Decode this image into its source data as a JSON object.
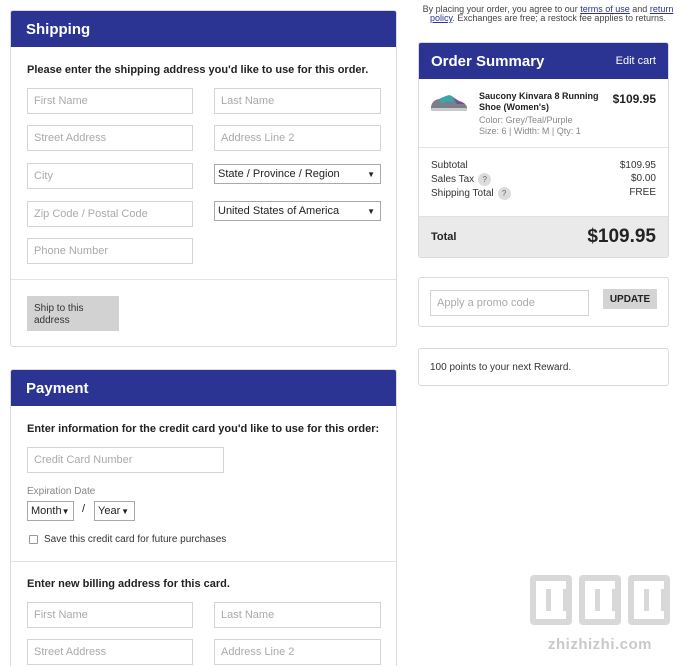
{
  "shipping": {
    "title": "Shipping",
    "instruction": "Please enter the shipping address you'd like to use for this order.",
    "first_name_placeholder": "First Name",
    "last_name_placeholder": "Last Name",
    "street_placeholder": "Street Address",
    "address2_placeholder": "Address Line 2",
    "city_placeholder": "City",
    "state_select": "State / Province / Region",
    "zip_placeholder": "Zip Code / Postal Code",
    "country_select": "United States of America",
    "phone_placeholder": "Phone Number",
    "submit_label": "Ship to this address"
  },
  "payment": {
    "title": "Payment",
    "instruction": "Enter information for the credit card you'd like to use for this order:",
    "card_placeholder": "Credit Card Number",
    "expiration_label": "Expiration Date",
    "month_select": "Month",
    "separator": "/",
    "year_select": "Year",
    "save_card_label": "Save this credit card for future purchases",
    "billing_instruction": "Enter new billing address for this card.",
    "first_name_placeholder": "First Name",
    "last_name_placeholder": "Last Name",
    "street_placeholder": "Street Address",
    "address2_placeholder": "Address Line 2"
  },
  "legal": {
    "prefix": "By placing your order, you agree to our",
    "terms_link": "terms of use",
    "and": "and",
    "return_link": "return policy",
    "suffix": ". Exchanges are free; a restock fee applies to returns."
  },
  "summary": {
    "title": "Order Summary",
    "edit_cart": "Edit cart",
    "product": {
      "name": "Saucony Kinvara 8 Running Shoe (Women's)",
      "color": "Color: Grey/Teal/Purple",
      "details": "Size: 6 | Width: M | Qty: 1",
      "price": "$109.95",
      "image_colors": [
        "#7a7f8a",
        "#3aa6a8",
        "#7a4aa0"
      ]
    },
    "subtotal_label": "Subtotal",
    "subtotal_value": "$109.95",
    "tax_label": "Sales Tax",
    "tax_value": "$0.00",
    "shipping_label": "Shipping Total",
    "shipping_value": "FREE",
    "help_glyph": "?",
    "total_label": "Total",
    "total_value": "$109.95"
  },
  "promo": {
    "placeholder": "Apply a promo code",
    "button": "UPDATE"
  },
  "rewards": {
    "text": "100 points to your next Reward."
  },
  "watermark": {
    "text": "zhizhizhi.com"
  },
  "colors": {
    "brand_header": "#2b3393",
    "link": "#2b3393",
    "button_gray": "#d2d2d2"
  }
}
